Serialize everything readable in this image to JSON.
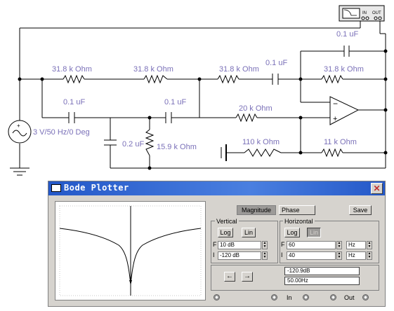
{
  "schematic": {
    "source_label": "3 V/50 Hz/0 Deg",
    "resistors": {
      "r1": "31.8 k Ohm",
      "r2": "31.8 k Ohm",
      "r3": "31.8 k Ohm",
      "r4": "31.8 k Ohm",
      "r5": "20 k Ohm",
      "r6": "15.9 k Ohm",
      "r7": "110 k Ohm",
      "r8": "11 k Ohm"
    },
    "capacitors": {
      "c1": "0.1 uF",
      "c2": "0.1 uF",
      "c3": "0.1 uF",
      "c4": "0.1 uF",
      "c5": "0.2 uF"
    },
    "instrument_in": "IN",
    "instrument_out": "OUT",
    "opamp_minus": "−",
    "opamp_plus": "+"
  },
  "bode": {
    "title": "Bode Plotter",
    "close_glyph": "✕",
    "magnitude_label": "Magnitude",
    "phase_label": "Phase",
    "save_label": "Save",
    "vertical": {
      "title": "Vertical",
      "log_label": "Log",
      "lin_label": "Lin",
      "f_label": "F",
      "i_label": "I",
      "f_value": "10 dB",
      "i_value": "-120 dB"
    },
    "horizontal": {
      "title": "Horizontal",
      "log_label": "Log",
      "lin_label": "Lin",
      "f_label": "F",
      "i_label": "I",
      "f_value": "60",
      "i_value": "40",
      "f_unit": "Hz",
      "i_unit": "Hz"
    },
    "left_arrow": "←",
    "right_arrow": "→",
    "readout_db": "-120.9dB",
    "readout_hz": "50.00Hz",
    "in_label": "In",
    "out_label": "Out"
  },
  "colors": {
    "titlebar": "#2a5fd0",
    "label_text": "#7a70b8",
    "panel_bg": "#d6d3ce"
  }
}
